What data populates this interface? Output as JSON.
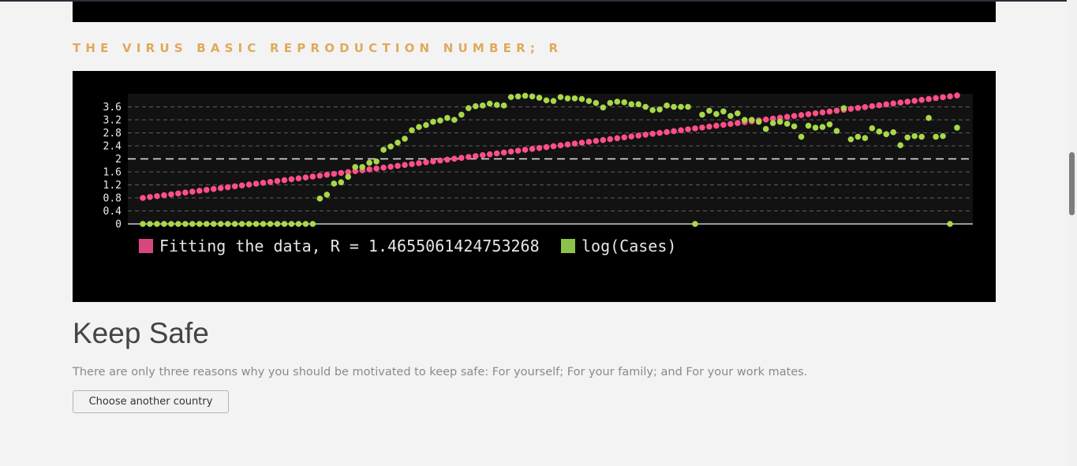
{
  "section": {
    "heading": "THE VIRUS BASIC REPRODUCTION NUMBER; R"
  },
  "chart_data": {
    "type": "scatter",
    "y_ticks": [
      "0",
      "0.4",
      "0.8",
      "1.2",
      "1.6",
      "2",
      "2.4",
      "2.8",
      "3.2",
      "3.6"
    ],
    "ylim": [
      0,
      4
    ],
    "x_index_range": [
      0,
      115
    ],
    "grid": true,
    "legend_position": "bottom-left",
    "colors": {
      "fit": "#ff4f87",
      "cases": "#a8d84a",
      "legend_fit": "#d9467e",
      "legend_cases": "#8bc34a"
    },
    "series": [
      {
        "name": "Fitting the data, R = 1.4655061424753268",
        "type": "line-points",
        "x_start": 0,
        "x_end": 115,
        "y_start": 0.8,
        "y_end": 3.95
      },
      {
        "name": "log(Cases)",
        "x": [
          0,
          1,
          2,
          3,
          4,
          5,
          6,
          7,
          8,
          9,
          10,
          11,
          12,
          13,
          14,
          15,
          16,
          17,
          18,
          19,
          20,
          21,
          22,
          23,
          24,
          25,
          26,
          27,
          28,
          29,
          30,
          31,
          32,
          33,
          34,
          35,
          36,
          37,
          38,
          39,
          40,
          41,
          42,
          43,
          44,
          45,
          46,
          47,
          48,
          49,
          50,
          51,
          52,
          53,
          54,
          55,
          56,
          57,
          58,
          59,
          60,
          61,
          62,
          63,
          64,
          65,
          66,
          67,
          68,
          69,
          70,
          71,
          72,
          73,
          74,
          75,
          76,
          77,
          78,
          79,
          80,
          81,
          82,
          83,
          84,
          85,
          86,
          87,
          88,
          89,
          90,
          91,
          92,
          93,
          94,
          95,
          96,
          97,
          98,
          99,
          100,
          101,
          102,
          103,
          104,
          105,
          106,
          107,
          108,
          109,
          110,
          111,
          112,
          113,
          114,
          115
        ],
        "values": [
          0,
          0,
          0,
          0,
          0,
          0,
          0,
          0,
          0,
          0,
          0,
          0,
          0,
          0,
          0,
          0,
          0,
          0,
          0,
          0,
          0,
          0,
          0,
          0,
          0,
          0.78,
          0.9,
          1.24,
          1.28,
          1.45,
          1.75,
          1.75,
          1.88,
          1.92,
          2.28,
          2.38,
          2.5,
          2.62,
          2.88,
          2.98,
          3.04,
          3.14,
          3.18,
          3.26,
          3.2,
          3.36,
          3.56,
          3.62,
          3.64,
          3.7,
          3.66,
          3.64,
          3.9,
          3.92,
          3.94,
          3.92,
          3.88,
          3.8,
          3.78,
          3.9,
          3.86,
          3.86,
          3.84,
          3.78,
          3.72,
          3.58,
          3.72,
          3.76,
          3.74,
          3.68,
          3.68,
          3.6,
          3.5,
          3.52,
          3.64,
          3.6,
          3.6,
          3.6,
          0,
          3.36,
          3.48,
          3.38,
          3.46,
          3.32,
          3.4,
          3.2,
          3.2,
          3.14,
          2.92,
          3.1,
          3.14,
          3.08,
          3.0,
          2.68,
          3.02,
          2.96,
          2.98,
          3.06,
          2.86,
          3.56,
          2.6,
          2.68,
          2.64,
          2.94,
          2.84,
          2.76,
          2.82,
          2.42,
          2.66,
          2.7,
          2.68,
          3.26,
          2.68,
          2.7,
          0,
          2.96
        ]
      }
    ]
  },
  "keep_safe": {
    "title": "Keep Safe",
    "text": "There are only three reasons why you should be motivated to keep safe: For yourself; For your family; and For your work mates.",
    "button_label": "Choose another country"
  }
}
